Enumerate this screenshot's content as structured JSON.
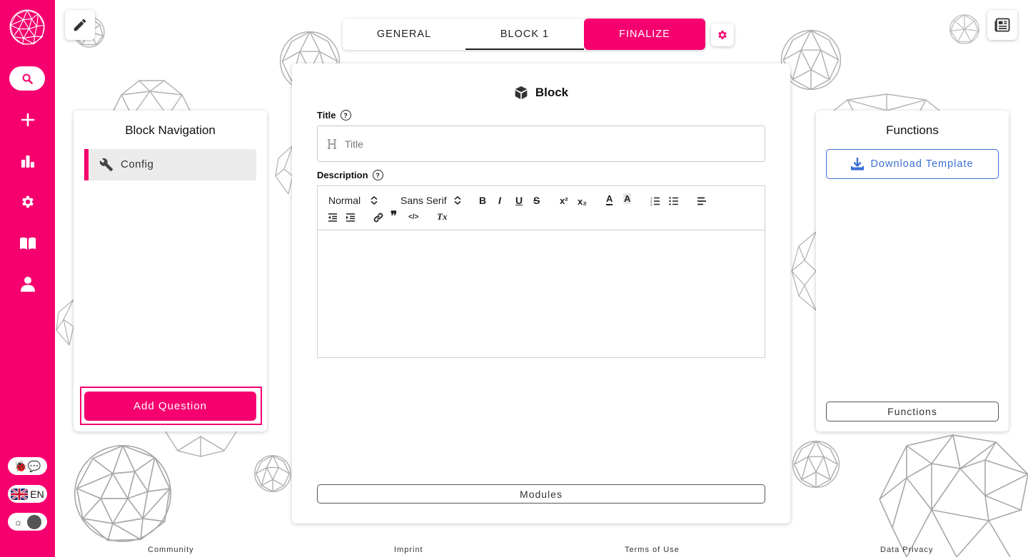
{
  "tabs": [
    {
      "label": "GENERAL"
    },
    {
      "label": "BLOCK 1"
    },
    {
      "label": "FINALIZE"
    }
  ],
  "left_panel": {
    "title": "Block Navigation",
    "items": [
      {
        "label": "Config",
        "icon": "wrench-icon"
      }
    ],
    "add_button": "Add Question"
  },
  "main_panel": {
    "title": "Block",
    "title_label": "Title",
    "title_placeholder": "Title",
    "description_label": "Description",
    "toolbar": {
      "header_select": "Normal",
      "font_select": "Sans Serif",
      "bold": "B",
      "italic": "I",
      "underline": "U",
      "strike": "S",
      "superscript": "x²",
      "subscript": "x₂",
      "color": "A",
      "background": "A",
      "code": "</>",
      "quote": "❞",
      "clean": "Tx"
    },
    "modules_button": "Modules"
  },
  "right_panel": {
    "title": "Functions",
    "download_button": "Download Template",
    "functions_button": "Functions"
  },
  "sidebar": {
    "items": [
      "search-icon",
      "plus-icon",
      "chart-icon",
      "gear-icon",
      "book-icon",
      "user-icon"
    ],
    "language": "EN"
  },
  "footer": {
    "links": [
      "Community",
      "Imprint",
      "Terms of Use",
      "Data Privacy"
    ]
  },
  "colors": {
    "accent": "#f5006e",
    "link": "#3b6fd4"
  }
}
